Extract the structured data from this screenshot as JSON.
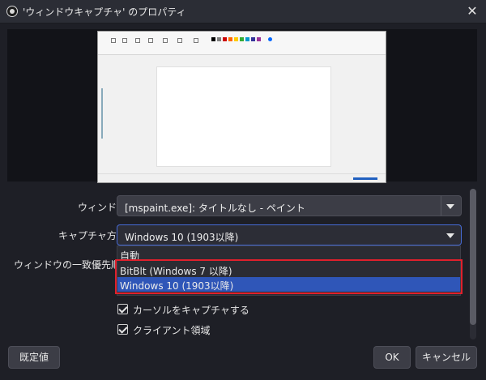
{
  "window": {
    "title": "'ウィンドウキャプチャ' のプロパティ",
    "close_glyph": "✕",
    "icon": "obs-logo-icon"
  },
  "preview": {
    "description_icon": "mspaint-window-thumbnail"
  },
  "form": {
    "window_label": "ウィンドウ",
    "window_value": "[mspaint.exe]: タイトルなし - ペイント",
    "capture_method_label": "キャプチャ方法",
    "capture_method_value": "Windows 10 (1903以降)",
    "priority_label": "ウィンドウの一致優先順位",
    "capture_method_options": [
      {
        "label": "自動",
        "selected": false
      },
      {
        "label": "BitBlt (Windows 7 以降)",
        "selected": false
      },
      {
        "label": "Windows 10 (1903以降)",
        "selected": true
      }
    ],
    "capture_cursor_label": "カーソルをキャプチャする",
    "capture_cursor_checked": true,
    "client_area_label": "クライアント領域",
    "client_area_checked": true
  },
  "buttons": {
    "defaults": "既定値",
    "ok": "OK",
    "cancel": "キャンセル"
  },
  "colors": {
    "highlight": "#2f56b8",
    "annotation_box": "#e0202c",
    "background": "#1e1f26"
  }
}
